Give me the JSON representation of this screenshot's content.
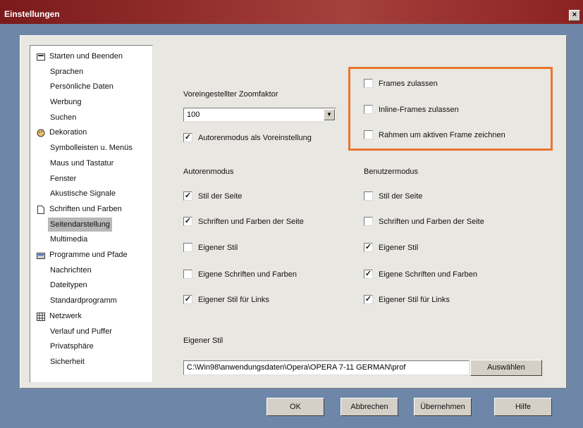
{
  "window": {
    "title": "Einstellungen",
    "close_label": "×"
  },
  "tree": {
    "items": [
      {
        "label": "Starten und Beenden",
        "icon": "folder-icon"
      },
      {
        "label": "Sprachen"
      },
      {
        "label": "Persönliche Daten"
      },
      {
        "label": "Werbung"
      },
      {
        "label": "Suchen"
      },
      {
        "label": "Dekoration",
        "icon": "palette-icon"
      },
      {
        "label": "Symbolleisten u. Menüs"
      },
      {
        "label": "Maus und Tastatur"
      },
      {
        "label": "Fenster"
      },
      {
        "label": "Akustische Signale"
      },
      {
        "label": "Schriften und Farben",
        "icon": "document-icon"
      },
      {
        "label": "Seitendarstellung",
        "selected": true
      },
      {
        "label": "Multimedia"
      },
      {
        "label": "Programme und Pfade",
        "icon": "drive-icon"
      },
      {
        "label": "Nachrichten"
      },
      {
        "label": "Dateitypen"
      },
      {
        "label": "Standardprogramm"
      },
      {
        "label": "Netzwerk",
        "icon": "network-icon"
      },
      {
        "label": "Verlauf und Puffer"
      },
      {
        "label": "Privatsphäre"
      },
      {
        "label": "Sicherheit"
      }
    ]
  },
  "zoom": {
    "label": "Voreingestellter Zoomfaktor",
    "value": "100"
  },
  "author_default": {
    "label": "Autorenmodus als Voreinstellung",
    "checked": true
  },
  "frames": {
    "allow_frames": {
      "label": "Frames zulassen",
      "checked": false
    },
    "allow_inline": {
      "label": "Inline-Frames zulassen",
      "checked": false
    },
    "border_active": {
      "label": "Rahmen um aktiven Frame zeichnen",
      "checked": false
    }
  },
  "author_mode": {
    "heading": "Autorenmodus",
    "items": [
      {
        "label": "Stil der Seite",
        "checked": true
      },
      {
        "label": "Schriften und Farben der Seite",
        "checked": true
      },
      {
        "label": "Eigener Stil",
        "checked": false
      },
      {
        "label": "Eigene Schriften und Farben",
        "checked": false
      },
      {
        "label": "Eigener Stil für Links",
        "checked": true
      }
    ]
  },
  "user_mode": {
    "heading": "Benutzermodus",
    "items": [
      {
        "label": "Stil der Seite",
        "checked": false
      },
      {
        "label": "Schriften und Farben der Seite",
        "checked": false
      },
      {
        "label": "Eigener Stil",
        "checked": true
      },
      {
        "label": "Eigene Schriften und Farben",
        "checked": true
      },
      {
        "label": "Eigener Stil für Links",
        "checked": true
      }
    ]
  },
  "custom_style": {
    "label": "Eigener Stil",
    "path": "C:\\Win98\\anwendungsdaten\\Opera\\OPERA 7-11 GERMAN\\prof",
    "choose_label": "Auswählen"
  },
  "buttons": {
    "ok": "OK",
    "cancel": "Abbrechen",
    "apply": "Übernehmen",
    "help": "Hilfe"
  },
  "colors": {
    "highlight": "#e8762c",
    "title_bar": "#8a2222",
    "frame_bg": "#6e87a8"
  }
}
